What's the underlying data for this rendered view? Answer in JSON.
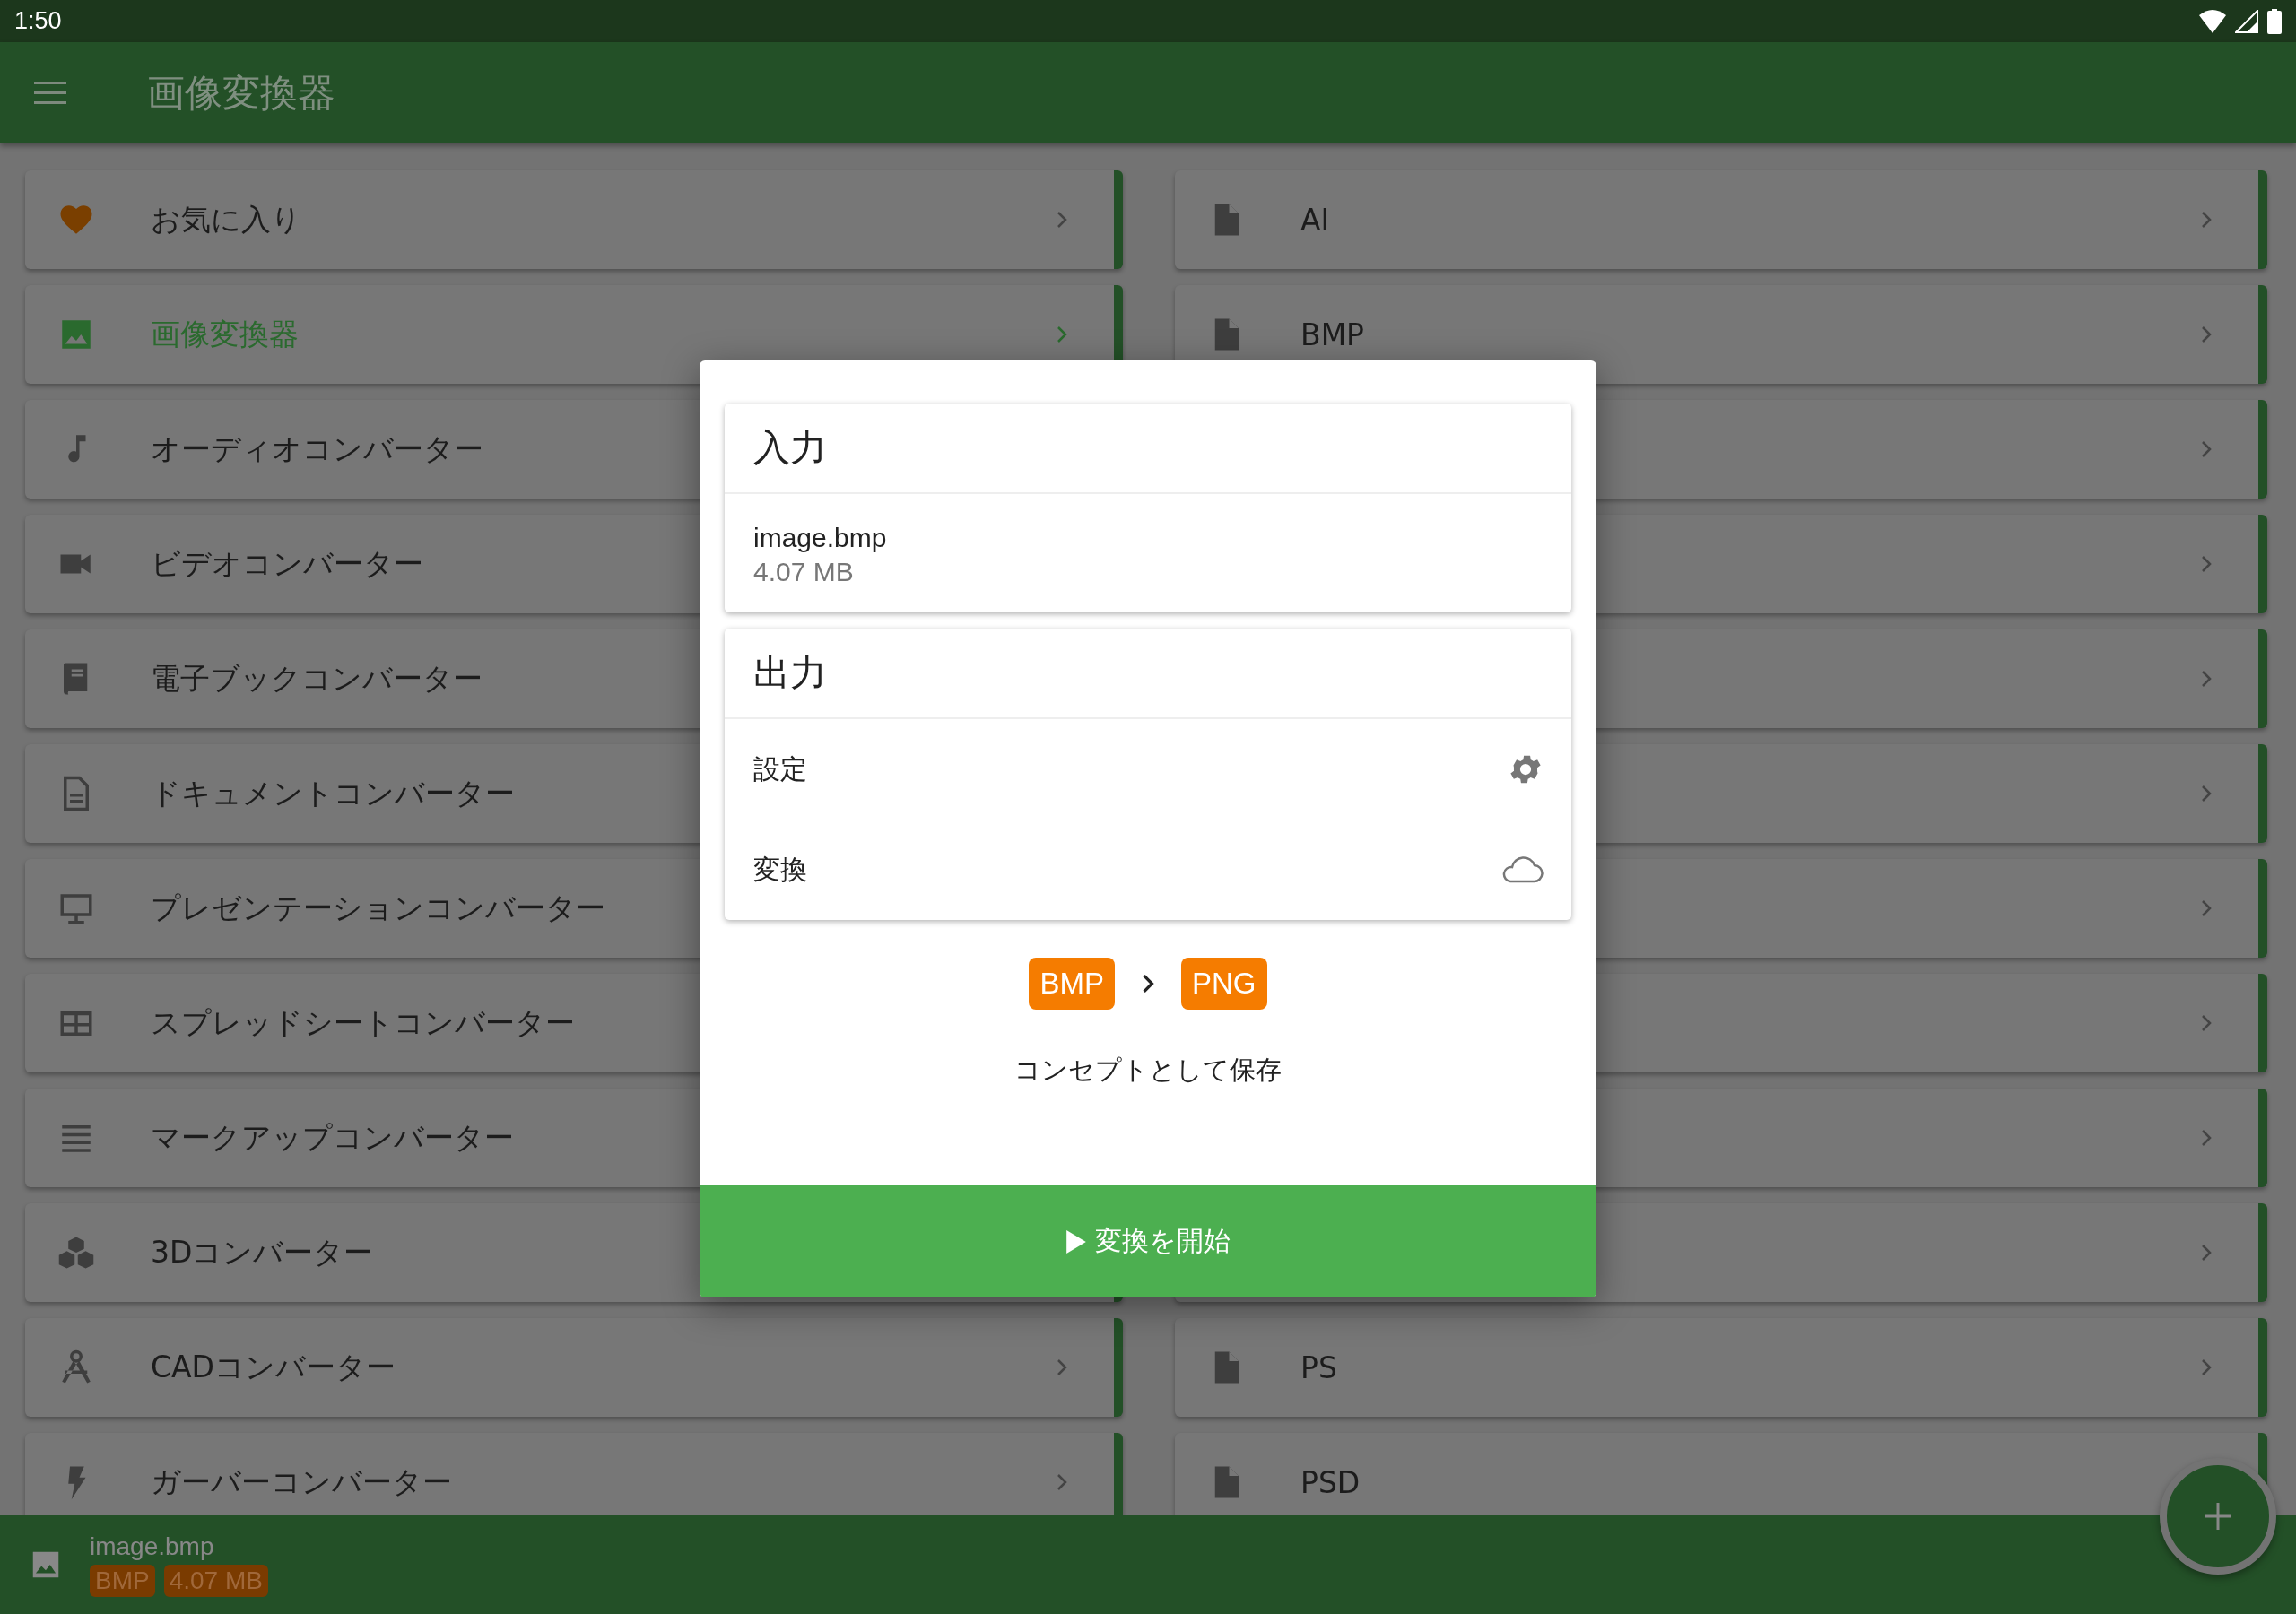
{
  "status_bar": {
    "time": "1:50"
  },
  "app_bar": {
    "title": "画像変換器"
  },
  "categories": [
    {
      "label": "お気に入り",
      "selected": false
    },
    {
      "label": "画像変換器",
      "selected": true
    },
    {
      "label": "オーディオコンバーター",
      "selected": false
    },
    {
      "label": "ビデオコンバーター",
      "selected": false
    },
    {
      "label": "電子ブックコンバーター",
      "selected": false
    },
    {
      "label": "ドキュメントコンバーター",
      "selected": false
    },
    {
      "label": "プレゼンテーションコンバーター",
      "selected": false
    },
    {
      "label": "スプレッドシートコンバーター",
      "selected": false
    },
    {
      "label": "マークアップコンバーター",
      "selected": false
    },
    {
      "label": "3Dコンバーター",
      "selected": false
    },
    {
      "label": "CADコンバーター",
      "selected": false
    },
    {
      "label": "ガーバーコンバーター",
      "selected": false
    }
  ],
  "formats": {
    "above_dialog": [
      {
        "label": "AI"
      },
      {
        "label": "BMP"
      }
    ],
    "below_dialog": [
      {
        "label": "PS"
      },
      {
        "label": "PSD"
      }
    ]
  },
  "dialog": {
    "input": {
      "title": "入力",
      "file_name": "image.bmp",
      "file_size": "4.07 MB"
    },
    "output": {
      "title": "出力",
      "rows": [
        {
          "label": "設定",
          "kind": "settings"
        },
        {
          "label": "変換",
          "kind": "cloud"
        }
      ]
    },
    "from_format": "BMP",
    "to_format": "PNG",
    "save_link": "コンセプトとして保存",
    "start_button": "変換を開始"
  },
  "bottom_bar": {
    "file_name": "image.bmp",
    "tags": [
      "BMP",
      "4.07 MB"
    ]
  }
}
